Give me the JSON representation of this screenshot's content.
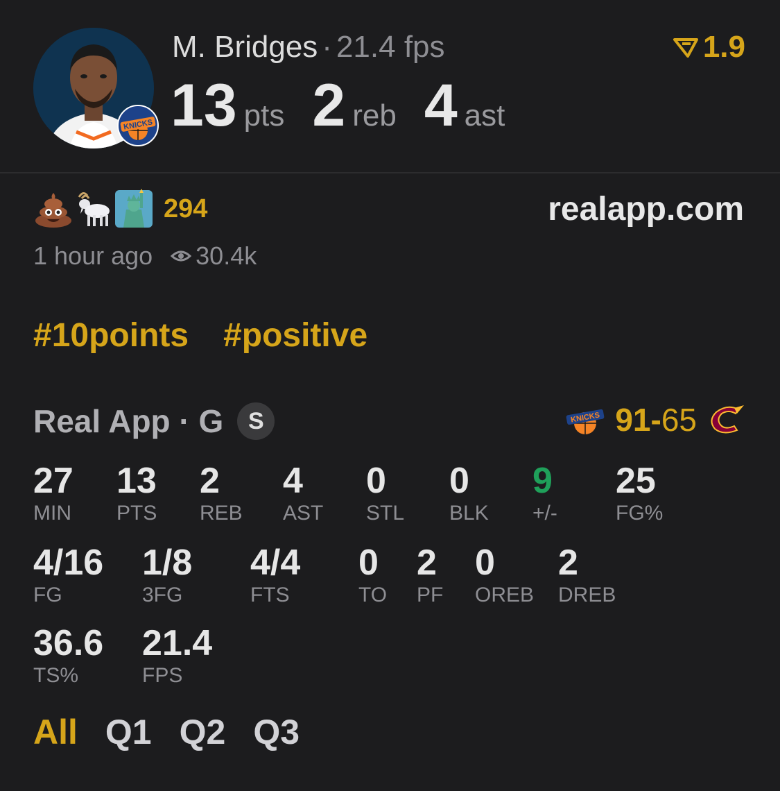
{
  "player": {
    "name": "M. Bridges",
    "fps": "21.4 fps",
    "rating": "1.9",
    "points": "13",
    "points_unit": "pts",
    "rebounds": "2",
    "rebounds_unit": "reb",
    "assists": "4",
    "assists_unit": "ast"
  },
  "reactions": {
    "count": "294",
    "emojis": [
      "poop-emoji",
      "goat-emoji",
      "statue-of-liberty-emoji"
    ]
  },
  "site": "realapp.com",
  "meta": {
    "time": "1 hour ago",
    "views": "30.4k"
  },
  "tags": [
    "#10points",
    "#positive"
  ],
  "game": {
    "title": "Real App · G",
    "position_badge": "S",
    "home_score": "91",
    "separator": "-",
    "away_score": "65",
    "home_team_icon": "knicks-logo",
    "away_team_icon": "cavaliers-logo"
  },
  "stats_row1": [
    {
      "value": "27",
      "label": "MIN"
    },
    {
      "value": "13",
      "label": "PTS"
    },
    {
      "value": "2",
      "label": "REB"
    },
    {
      "value": "4",
      "label": "AST"
    },
    {
      "value": "0",
      "label": "STL"
    },
    {
      "value": "0",
      "label": "BLK"
    },
    {
      "value": "9",
      "label": "+/-"
    },
    {
      "value": "25",
      "label": "FG%"
    }
  ],
  "stats_row2": [
    {
      "value": "4/16",
      "label": "FG"
    },
    {
      "value": "1/8",
      "label": "3FG"
    },
    {
      "value": "4/4",
      "label": "FTS"
    },
    {
      "value": "0",
      "label": "TO"
    },
    {
      "value": "2",
      "label": "PF"
    },
    {
      "value": "0",
      "label": "OREB"
    },
    {
      "value": "2",
      "label": "DREB"
    }
  ],
  "stats_row3": [
    {
      "value": "36.6",
      "label": "TS%"
    },
    {
      "value": "21.4",
      "label": "FPS"
    }
  ],
  "quarters": [
    "All",
    "Q1",
    "Q2",
    "Q3"
  ],
  "colors": {
    "accent": "#d6a51a",
    "positive": "#1fa05a",
    "background": "#1c1c1e"
  }
}
